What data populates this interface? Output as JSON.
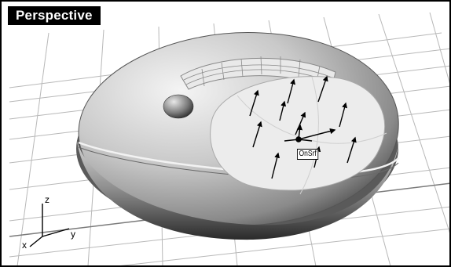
{
  "viewport": {
    "title": "Perspective",
    "osnap_label": "OnSrf",
    "axes": {
      "z": "z",
      "x": "x",
      "y": "y"
    }
  },
  "colors": {
    "background": "#ffffff",
    "grid": "#b8b8b8",
    "tab": "#000000",
    "arrows": "#000000"
  }
}
